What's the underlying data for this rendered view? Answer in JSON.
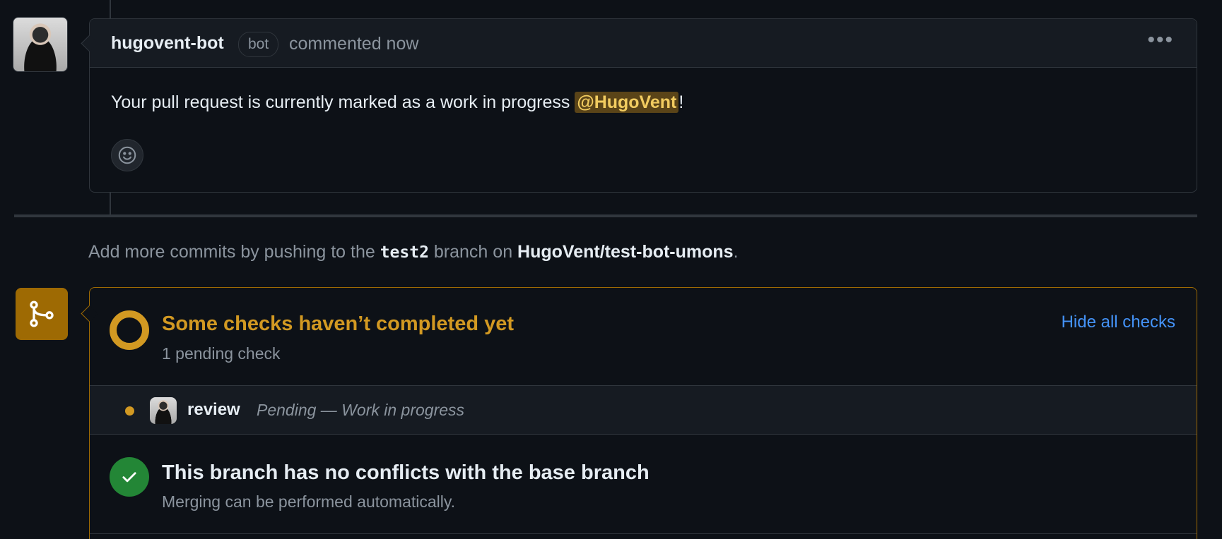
{
  "comment": {
    "author": "hugovent-bot",
    "badge": "bot",
    "time": "commented now",
    "body_prefix": "Your pull request is currently marked as a work in progress ",
    "mention": "@HugoVent",
    "body_suffix": "!",
    "menu_icon": "kebab-horizontal-icon",
    "reaction_icon": "smiley-icon"
  },
  "push_note": {
    "prefix": "Add more commits by pushing to the ",
    "branch": "test2",
    "middle": " branch on ",
    "repo": "HugoVent/test-bot-umons",
    "suffix": "."
  },
  "checks": {
    "title": "Some checks haven’t completed yet",
    "subtitle": "1 pending check",
    "toggle_label": "Hide all checks",
    "status_color": "#d29922",
    "items": [
      {
        "name": "review",
        "status": "Pending — Work in progress"
      }
    ]
  },
  "conflicts": {
    "title": "This branch has no conflicts with the base branch",
    "subtitle": "Merging can be performed automatically.",
    "status_color": "#238636"
  },
  "colors": {
    "background": "#0d1117",
    "link": "#4493f8",
    "pending": "#d29922",
    "success": "#238636"
  }
}
